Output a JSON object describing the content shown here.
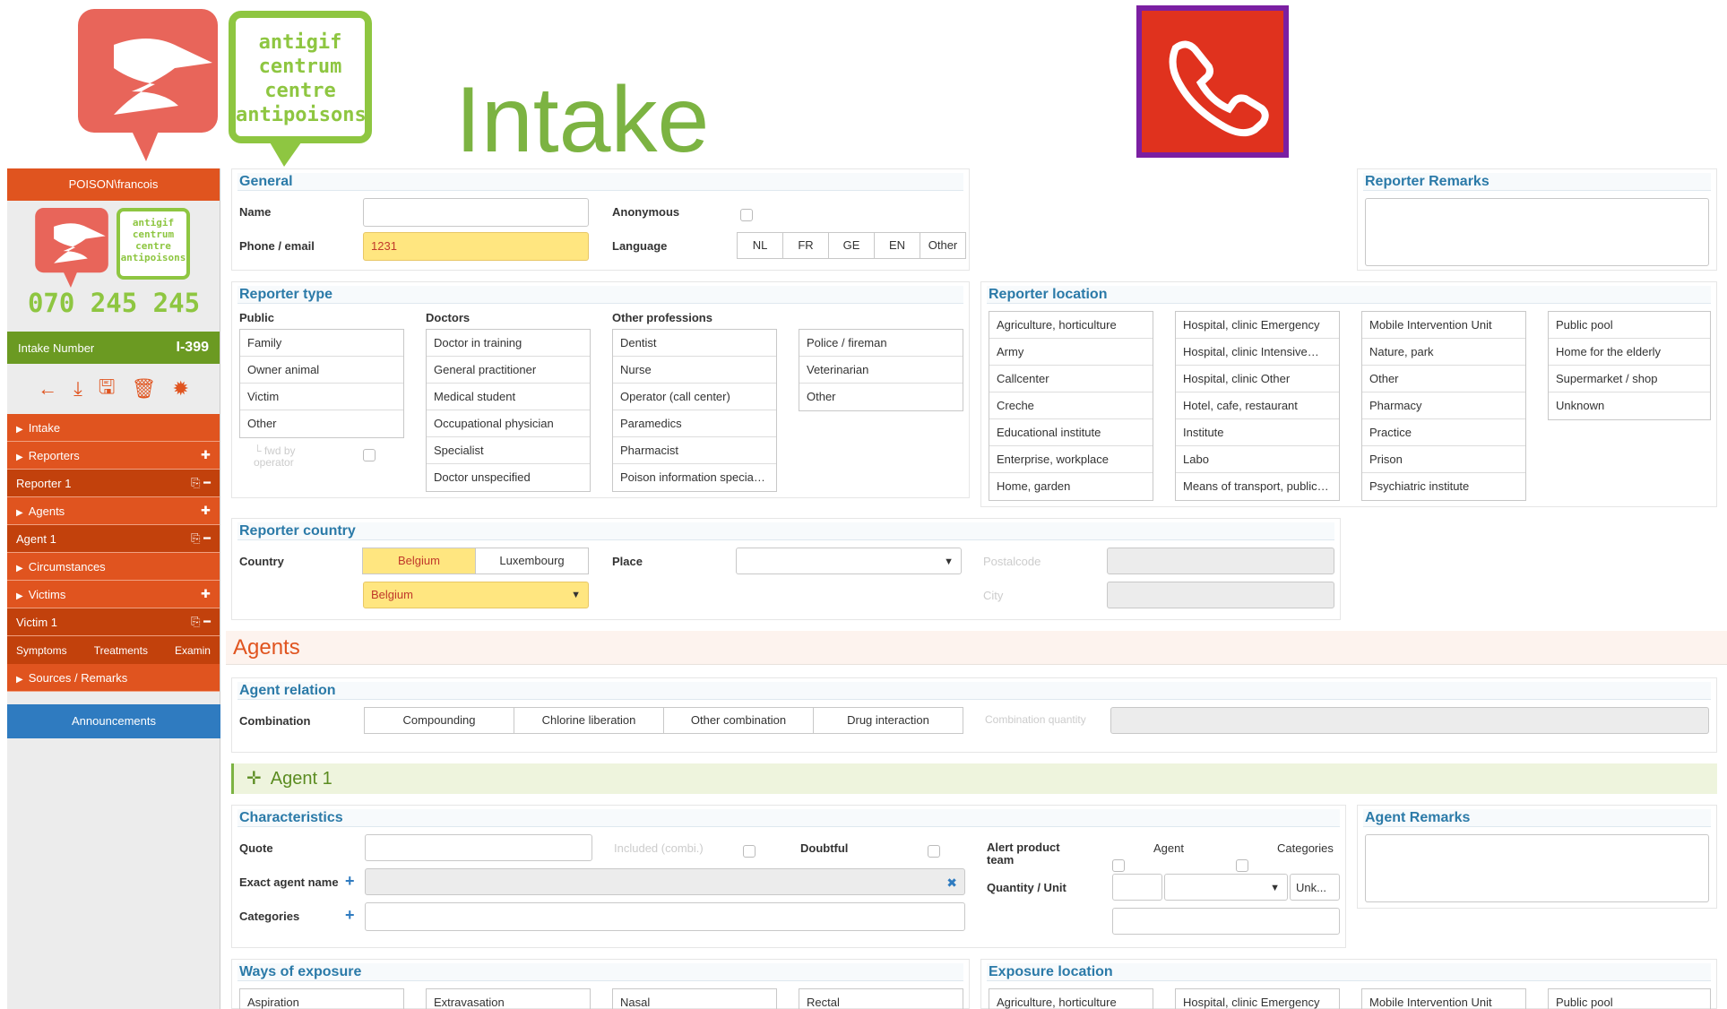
{
  "header": {
    "title": "Intake",
    "logo_green_text": [
      "antigif",
      "centrum",
      "centre",
      "antipoisons"
    ]
  },
  "sidebar": {
    "user": "POISON\\francois",
    "phone": "070 245 245",
    "intake_label": "Intake Number",
    "intake_number": "I-399",
    "items": [
      {
        "label": "Intake",
        "type": "main"
      },
      {
        "label": "Reporters",
        "type": "main"
      },
      {
        "label": "Reporter 1",
        "type": "sub"
      },
      {
        "label": "Agents",
        "type": "main"
      },
      {
        "label": "Agent 1",
        "type": "sub"
      },
      {
        "label": "Circumstances",
        "type": "main"
      },
      {
        "label": "Victims",
        "type": "main"
      },
      {
        "label": "Victim 1",
        "type": "sub"
      }
    ],
    "victim_tabs": [
      "Symptoms",
      "Treatments",
      "Examin"
    ],
    "sources": "Sources / Remarks",
    "announcements": "Announcements"
  },
  "general": {
    "title": "General",
    "name_label": "Name",
    "name_value": "",
    "phone_label": "Phone / email",
    "phone_value": "1231",
    "anonymous_label": "Anonymous",
    "language_label": "Language",
    "languages": [
      "NL",
      "FR",
      "GE",
      "EN",
      "Other"
    ]
  },
  "reporter_remarks": {
    "title": "Reporter Remarks",
    "value": ""
  },
  "reporter_type": {
    "title": "Reporter type",
    "public_label": "Public",
    "public": [
      "Family",
      "Owner animal",
      "Victim",
      "Other"
    ],
    "fwd_label": "└ fwd by operator",
    "doctors_label": "Doctors",
    "doctors": [
      "Doctor in training",
      "General practitioner",
      "Medical student",
      "Occupational physician",
      "Specialist",
      "Doctor unspecified"
    ],
    "other_label": "Other professions",
    "other1": [
      "Dentist",
      "Nurse",
      "Operator (call center)",
      "Paramedics",
      "Pharmacist",
      "Poison information specia…"
    ],
    "other2": [
      "Police / fireman",
      "Veterinarian",
      "Other"
    ]
  },
  "reporter_location": {
    "title": "Reporter location",
    "col1": [
      "Agriculture, horticulture",
      "Army",
      "Callcenter",
      "Creche",
      "Educational institute",
      "Enterprise, workplace",
      "Home, garden"
    ],
    "col2": [
      "Hospital, clinic Emergency",
      "Hospital, clinic Intensive…",
      "Hospital, clinic Other",
      "Hotel, cafe, restaurant",
      "Institute",
      "Labo",
      "Means of transport, public…"
    ],
    "col3": [
      "Mobile Intervention Unit",
      "Nature, park",
      "Other",
      "Pharmacy",
      "Practice",
      "Prison",
      "Psychiatric institute"
    ],
    "col4": [
      "Public pool",
      "Home for the elderly",
      "Supermarket / shop",
      "Unknown"
    ]
  },
  "reporter_country": {
    "title": "Reporter country",
    "country_label": "Country",
    "countries": [
      "Belgium",
      "Luxembourg"
    ],
    "selected_country": "Belgium",
    "country_select": "Belgium",
    "place_label": "Place",
    "postal_label": "Postalcode",
    "city_label": "City"
  },
  "agents_section": {
    "title": "Agents"
  },
  "agent_relation": {
    "title": "Agent relation",
    "combination_label": "Combination",
    "options": [
      "Compounding",
      "Chlorine liberation",
      "Other combination",
      "Drug interaction"
    ],
    "quantity_label": "Combination quantity"
  },
  "agent1": {
    "title": "Agent 1"
  },
  "characteristics": {
    "title": "Characteristics",
    "quote_label": "Quote",
    "included_label": "Included (combi.)",
    "doubtful_label": "Doubtful",
    "exact_label": "Exact agent name",
    "categories_label": "Categories",
    "alert_label": "Alert product team",
    "agent_label": "Agent",
    "categories_col_label": "Categories",
    "quantity_label": "Quantity / Unit",
    "unit_value": "Unk..."
  },
  "agent_remarks": {
    "title": "Agent Remarks"
  },
  "ways_of_exposure": {
    "title": "Ways of exposure",
    "items": [
      "Aspiration",
      "Extravasation",
      "Nasal",
      "Rectal"
    ]
  },
  "exposure_location": {
    "title": "Exposure location",
    "items": [
      "Agriculture, horticulture",
      "Hospital, clinic Emergency",
      "Mobile Intervention Unit",
      "Public pool"
    ]
  },
  "colors": {
    "brand_orange": "#e0541f",
    "brand_green": "#8ec641",
    "panel_title": "#2b7aa8",
    "highlight": "#ffe680",
    "announce_blue": "#2f7bc0"
  }
}
